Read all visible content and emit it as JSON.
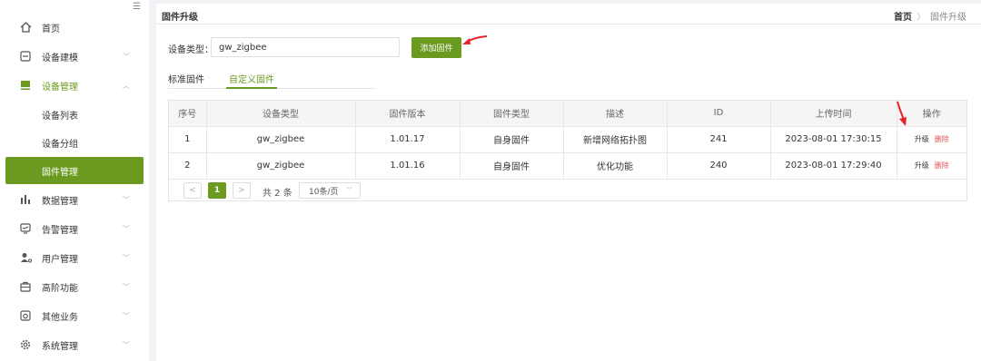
{
  "sidebar": {
    "collapse_glyph": "☰",
    "items": [
      {
        "label": "首页",
        "icon": "home-icon",
        "chevron": ""
      },
      {
        "label": "设备建模",
        "icon": "model-icon",
        "chevron": "﹀"
      },
      {
        "label": "设备管理",
        "icon": "device-icon",
        "chevron": "︿"
      },
      {
        "label": "设备列表"
      },
      {
        "label": "设备分组"
      },
      {
        "label": "固件管理"
      },
      {
        "label": "数据管理",
        "icon": "chart-icon",
        "chevron": "﹀"
      },
      {
        "label": "告警管理",
        "icon": "alarm-icon",
        "chevron": "﹀"
      },
      {
        "label": "用户管理",
        "icon": "user-icon",
        "chevron": "﹀"
      },
      {
        "label": "高阶功能",
        "icon": "advanced-icon",
        "chevron": "﹀"
      },
      {
        "label": "其他业务",
        "icon": "other-icon",
        "chevron": "﹀"
      },
      {
        "label": "系统管理",
        "icon": "gear-icon",
        "chevron": "﹀"
      }
    ]
  },
  "header": {
    "title": "固件升级",
    "breadcrumb_home": "首页",
    "breadcrumb_sep": "〉",
    "breadcrumb_current": "固件升级"
  },
  "filter": {
    "label": "设备类型：",
    "value": "gw_zigbee",
    "add_button": "添加固件"
  },
  "tabs": [
    "标准固件",
    "自定义固件"
  ],
  "active_tab": 1,
  "table": {
    "columns": [
      "序号",
      "设备类型",
      "固件版本",
      "固件类型",
      "描述",
      "ID",
      "上传时间",
      "操作"
    ],
    "rows": [
      {
        "index": "1",
        "device_type": "gw_zigbee",
        "version": "1.01.17",
        "fw_type": "自身固件",
        "desc": "新增网络拓扑图",
        "id": "241",
        "uploaded": "2023-08-01 17:30:15",
        "op_upgrade": "升级",
        "op_delete": "删除"
      },
      {
        "index": "2",
        "device_type": "gw_zigbee",
        "version": "1.01.16",
        "fw_type": "自身固件",
        "desc": "优化功能",
        "id": "240",
        "uploaded": "2023-08-01 17:29:40",
        "op_upgrade": "升级",
        "op_delete": "删除"
      }
    ]
  },
  "pager": {
    "prev": "<",
    "current": "1",
    "next": ">",
    "total": "共 2 条",
    "page_size": "10条/页",
    "caret": "﹀"
  },
  "colors": {
    "accent": "#6a9a1f",
    "danger": "#e05252",
    "annotation": "#e8202a"
  }
}
